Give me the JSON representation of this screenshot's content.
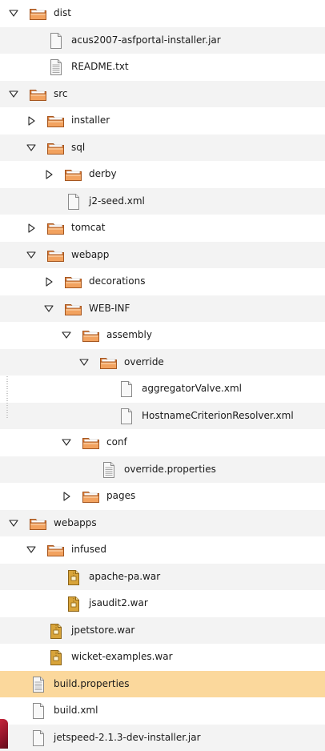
{
  "colors": {
    "selection": "#fbd89c",
    "alt_row": "#f3f3f3",
    "folder_body": "#f2a25f",
    "folder_tab": "#e07b34",
    "file_page": "#f8f8f8",
    "archive": "#d8a43a"
  },
  "tree": {
    "nodes": [
      {
        "label": "dist",
        "icon": "folder-icon",
        "expander": "open"
      },
      {
        "label": "acus2007-asfportal-installer.jar",
        "icon": "file-icon"
      },
      {
        "label": "README.txt",
        "icon": "text-file-icon"
      },
      {
        "label": "src",
        "icon": "folder-icon",
        "expander": "open"
      },
      {
        "label": "installer",
        "icon": "folder-icon",
        "expander": "closed"
      },
      {
        "label": "sql",
        "icon": "folder-icon",
        "expander": "open"
      },
      {
        "label": "derby",
        "icon": "folder-icon",
        "expander": "closed"
      },
      {
        "label": "j2-seed.xml",
        "icon": "file-icon"
      },
      {
        "label": "tomcat",
        "icon": "folder-icon",
        "expander": "closed"
      },
      {
        "label": "webapp",
        "icon": "folder-icon",
        "expander": "open"
      },
      {
        "label": "decorations",
        "icon": "folder-icon",
        "expander": "closed"
      },
      {
        "label": "WEB-INF",
        "icon": "folder-icon",
        "expander": "open"
      },
      {
        "label": "assembly",
        "icon": "folder-icon",
        "expander": "open"
      },
      {
        "label": "override",
        "icon": "folder-icon",
        "expander": "open"
      },
      {
        "label": "aggregatorValve.xml",
        "icon": "file-icon"
      },
      {
        "label": "HostnameCriterionResolver.xml",
        "icon": "file-icon"
      },
      {
        "label": "conf",
        "icon": "folder-icon",
        "expander": "open"
      },
      {
        "label": "override.properties",
        "icon": "text-file-icon"
      },
      {
        "label": "pages",
        "icon": "folder-icon",
        "expander": "closed"
      },
      {
        "label": "webapps",
        "icon": "folder-icon",
        "expander": "open"
      },
      {
        "label": "infused",
        "icon": "folder-icon",
        "expander": "open"
      },
      {
        "label": "apache-pa.war",
        "icon": "archive-icon"
      },
      {
        "label": "jsaudit2.war",
        "icon": "archive-icon"
      },
      {
        "label": "jpetstore.war",
        "icon": "archive-icon"
      },
      {
        "label": "wicket-examples.war",
        "icon": "archive-icon"
      },
      {
        "label": "build.properties",
        "icon": "text-file-icon",
        "selected": true
      },
      {
        "label": "build.xml",
        "icon": "file-icon"
      },
      {
        "label": "jetspeed-2.1.3-dev-installer.jar",
        "icon": "file-icon"
      }
    ]
  }
}
